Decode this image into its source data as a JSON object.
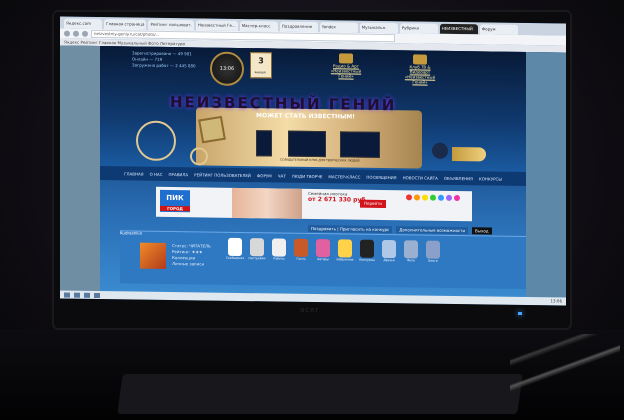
{
  "browser": {
    "tabs": [
      "Яндекс.com",
      "Главная страница",
      "Рейтинг пользоват.",
      "Неизвестный Ге...",
      "Мастер-класс",
      "Поздравления",
      "Yandex",
      "Музыкальн.",
      "Рубрики",
      "НЕИЗВЕСТНЫЙ",
      "Форум"
    ],
    "active_tab": 9,
    "url": "neizvestniy-geniy.ru/cat/photo/...",
    "bookmarks": "Яндекс   Рейтинг   Главная   Музыкальный   Фото   Литература"
  },
  "site": {
    "stats": [
      "Зарегистрировано — 49 981",
      "Онлайн — 719",
      "Загружено работ — 2 445 880"
    ],
    "clock": "13:06",
    "calendar_day": "3",
    "calendar_month": "января",
    "radio": "Радио & Арт «Неизвестный Гений»",
    "club": "Клуб ТВ & Видеоарт «Неизвестный Гений»",
    "logo": "НЕИЗВЕСТНЫЙ ГЕНИЙ",
    "slogan": "МОЖЕТ СТАТЬ ИЗВЕСТНЫМ!",
    "tagline": "СОЗИДАТЕЛЬНЫЙ КЛУБ ДЛЯ ТВОРЧЕСКИХ ЛЮДЕЙ",
    "menu": [
      "ГЛАВНАЯ",
      "О НАС",
      "ПРАВИЛА",
      "РЕЙТИНГ ПОЛЬЗОВАТЕЛЕЙ",
      "ФОРУМ",
      "ЧАТ",
      "ЛЮДИ ТВОРЧЕ",
      "МАСТЕР-КЛАСС",
      "ПОСВЯЩЕНИЯ",
      "НОВОСТИ САЙТА",
      "ОБЪЯВЛЕНИЯ",
      "КОНКУРСЫ"
    ]
  },
  "ad": {
    "brand": "ПИК",
    "brand_sub": "ГОРОД",
    "line1": "Семейная ипотека",
    "price": "от 2 671 330 руб.",
    "button": "Перейти",
    "ages_colors": [
      "#e33",
      "#f90",
      "#fd0",
      "#3c3",
      "#39f",
      "#96f",
      "#e3a"
    ]
  },
  "content_tabs": [
    "Поздравить | Пригласить на конкурс",
    "Дополнительные возможности",
    "Выход"
  ],
  "user": {
    "name": "Kudrashkin",
    "status_lines": [
      "Статус: ЧИТАТЕЛЬ",
      "Рейтинг: ★★★",
      "Коллекции",
      "Личные записи"
    ],
    "icons": [
      {
        "label": "Сообщения",
        "color": "#ffffff"
      },
      {
        "label": "Настройки",
        "color": "#d8d8d8"
      },
      {
        "label": "Работы",
        "color": "#f0f0f0"
      },
      {
        "label": "Гости",
        "color": "#c85a2a"
      },
      {
        "label": "Авторы",
        "color": "#e060a0"
      },
      {
        "label": "Избранное",
        "color": "#ffd24a"
      },
      {
        "label": "Конкурсы",
        "color": "#222222"
      },
      {
        "label": "Друзья",
        "color": "#b0c8e8"
      },
      {
        "label": "Фото",
        "color": "#9ab0d0"
      },
      {
        "label": "Блоги",
        "color": "#8aa0c8"
      }
    ]
  },
  "taskbar": {
    "clock": "13:06"
  },
  "monitor_brand": "acer"
}
